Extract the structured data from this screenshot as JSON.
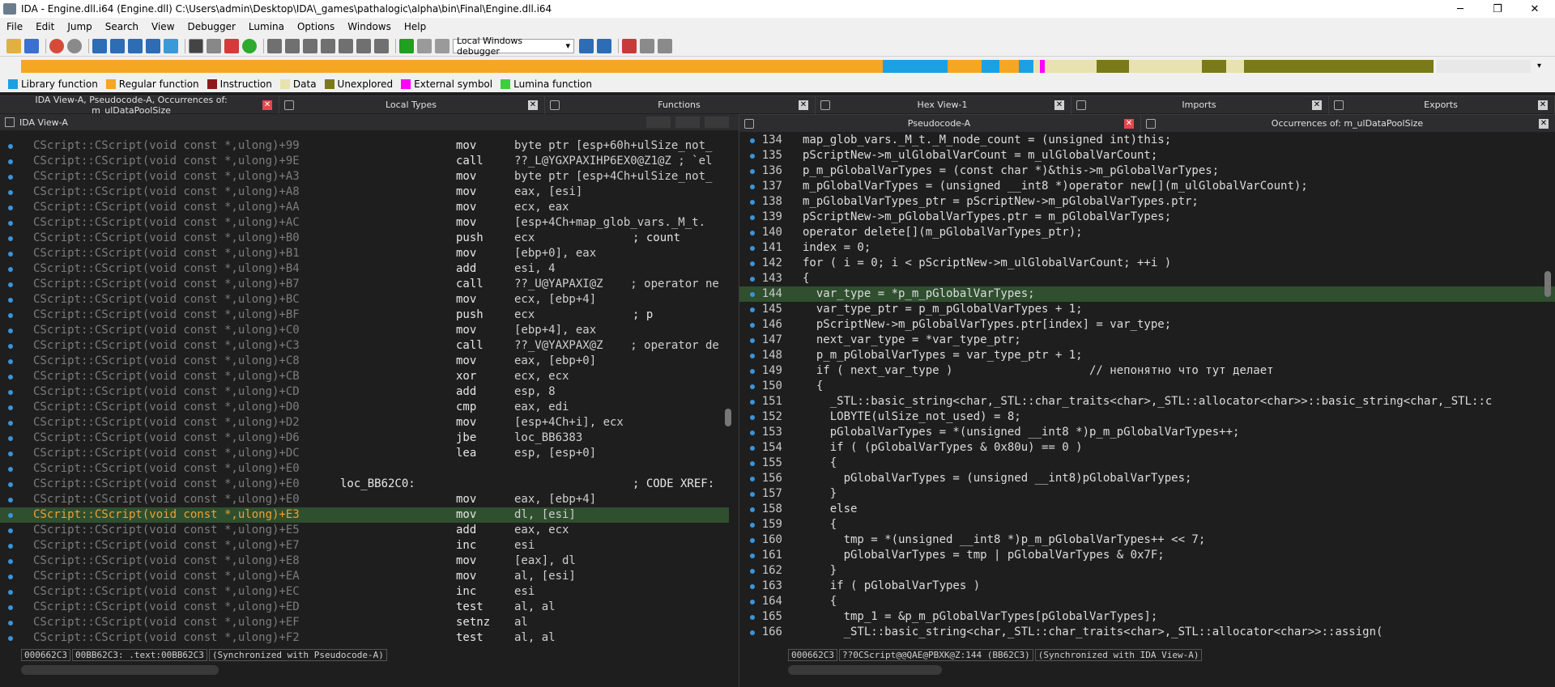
{
  "title": "IDA - Engine.dll.i64 (Engine.dll) C:\\Users\\admin\\Desktop\\IDA\\_games\\pathalogic\\alpha\\bin\\Final\\Engine.dll.i64",
  "window_controls": {
    "minimize": "─",
    "restore": "❐",
    "close": "✕"
  },
  "menu": [
    "File",
    "Edit",
    "Jump",
    "Search",
    "View",
    "Debugger",
    "Lumina",
    "Options",
    "Windows",
    "Help"
  ],
  "toolbar": {
    "debugger": "Local Windows debugger",
    "dropdown": "▾"
  },
  "legend": [
    {
      "label": "Library function",
      "color": "#1ba1e2"
    },
    {
      "label": "Regular function",
      "color": "#f5a623"
    },
    {
      "label": "Instruction",
      "color": "#8b1a1a"
    },
    {
      "label": "Data",
      "color": "#e8e2b0"
    },
    {
      "label": "Unexplored",
      "color": "#7a7a1a"
    },
    {
      "label": "External symbol",
      "color": "#ff00ff"
    },
    {
      "label": "Lumina function",
      "color": "#3ad13a"
    }
  ],
  "tabs_top": [
    {
      "label": "IDA View-A, Pseudocode-A, Occurrences of: m_ulDataPoolSize",
      "close": "✕"
    },
    {
      "label": "Local Types",
      "close": "✕"
    },
    {
      "label": "Functions",
      "close": "✕"
    },
    {
      "label": "Hex View-1",
      "close": "✕"
    },
    {
      "label": "Imports",
      "close": "✕"
    },
    {
      "label": "Exports",
      "close": "✕"
    }
  ],
  "ida_view": {
    "title": "IDA View-A"
  },
  "pseudo_tabs": [
    {
      "label": "Pseudocode-A",
      "close": "✕"
    },
    {
      "label": "Occurrences of: m_ulDataPoolSize",
      "close": "✕"
    }
  ],
  "disasm": [
    {
      "addr": "CScript::CScript(void const *,ulong)+99",
      "mn": "mov",
      "op": "byte ptr [esp+60h+ulSize_not_",
      "cm": ""
    },
    {
      "addr": "CScript::CScript(void const *,ulong)+9E",
      "mn": "call",
      "op": "??_L@YGXPAXIHP6EX0@Z1@Z ; `el",
      "cm": ""
    },
    {
      "addr": "CScript::CScript(void const *,ulong)+A3",
      "mn": "mov",
      "op": "byte ptr [esp+4Ch+ulSize_not_",
      "cm": ""
    },
    {
      "addr": "CScript::CScript(void const *,ulong)+A8",
      "mn": "mov",
      "op": "eax, [esi]",
      "cm": ""
    },
    {
      "addr": "CScript::CScript(void const *,ulong)+AA",
      "mn": "mov",
      "op": "ecx, eax",
      "cm": ""
    },
    {
      "addr": "CScript::CScript(void const *,ulong)+AC",
      "mn": "mov",
      "op": "[esp+4Ch+map_glob_vars._M_t.",
      "cm": ""
    },
    {
      "addr": "CScript::CScript(void const *,ulong)+B0",
      "mn": "push",
      "op": "ecx",
      "cm": "; count"
    },
    {
      "addr": "CScript::CScript(void const *,ulong)+B1",
      "mn": "mov",
      "op": "[ebp+0], eax",
      "cm": ""
    },
    {
      "addr": "CScript::CScript(void const *,ulong)+B4",
      "mn": "add",
      "op": "esi, 4",
      "cm": ""
    },
    {
      "addr": "CScript::CScript(void const *,ulong)+B7",
      "mn": "call",
      "op": "??_U@YAPAXI@Z    ; operator ne",
      "cm": ""
    },
    {
      "addr": "CScript::CScript(void const *,ulong)+BC",
      "mn": "mov",
      "op": "ecx, [ebp+4]",
      "cm": ""
    },
    {
      "addr": "CScript::CScript(void const *,ulong)+BF",
      "mn": "push",
      "op": "ecx",
      "cm": "; p"
    },
    {
      "addr": "CScript::CScript(void const *,ulong)+C0",
      "mn": "mov",
      "op": "[ebp+4], eax",
      "cm": ""
    },
    {
      "addr": "CScript::CScript(void const *,ulong)+C3",
      "mn": "call",
      "op": "??_V@YAXPAX@Z    ; operator de",
      "cm": ""
    },
    {
      "addr": "CScript::CScript(void const *,ulong)+C8",
      "mn": "mov",
      "op": "eax, [ebp+0]",
      "cm": ""
    },
    {
      "addr": "CScript::CScript(void const *,ulong)+CB",
      "mn": "xor",
      "op": "ecx, ecx",
      "cm": ""
    },
    {
      "addr": "CScript::CScript(void const *,ulong)+CD",
      "mn": "add",
      "op": "esp, 8",
      "cm": ""
    },
    {
      "addr": "CScript::CScript(void const *,ulong)+D0",
      "mn": "cmp",
      "op": "eax, edi",
      "cm": ""
    },
    {
      "addr": "CScript::CScript(void const *,ulong)+D2",
      "mn": "mov",
      "op": "[esp+4Ch+i], ecx",
      "cm": ""
    },
    {
      "addr": "CScript::CScript(void const *,ulong)+D6",
      "mn": "jbe",
      "op": "loc_BB6383",
      "cm": ""
    },
    {
      "addr": "CScript::CScript(void const *,ulong)+DC",
      "mn": "lea",
      "op": "esp, [esp+0]",
      "cm": ""
    },
    {
      "addr": "CScript::CScript(void const *,ulong)+E0",
      "mn": "",
      "op": "",
      "cm": ""
    },
    {
      "addr": "CScript::CScript(void const *,ulong)+E0",
      "lbl": "loc_BB62C0:",
      "mn": "",
      "op": "",
      "cm": "; CODE XREF:"
    },
    {
      "addr": "CScript::CScript(void const *,ulong)+E0",
      "mn": "mov",
      "op": "eax, [ebp+4]",
      "cm": ""
    },
    {
      "addr": "CScript::CScript(void const *,ulong)+E3",
      "mn": "mov",
      "op": "dl, [esi]",
      "cm": "",
      "hl": true
    },
    {
      "addr": "CScript::CScript(void const *,ulong)+E5",
      "mn": "add",
      "op": "eax, ecx",
      "cm": ""
    },
    {
      "addr": "CScript::CScript(void const *,ulong)+E7",
      "mn": "inc",
      "op": "esi",
      "cm": ""
    },
    {
      "addr": "CScript::CScript(void const *,ulong)+E8",
      "mn": "mov",
      "op": "[eax], dl",
      "cm": ""
    },
    {
      "addr": "CScript::CScript(void const *,ulong)+EA",
      "mn": "mov",
      "op": "al, [esi]",
      "cm": ""
    },
    {
      "addr": "CScript::CScript(void const *,ulong)+EC",
      "mn": "inc",
      "op": "esi",
      "cm": ""
    },
    {
      "addr": "CScript::CScript(void const *,ulong)+ED",
      "mn": "test",
      "op": "al, al",
      "cm": ""
    },
    {
      "addr": "CScript::CScript(void const *,ulong)+EF",
      "mn": "setnz",
      "op": "al",
      "cm": ""
    },
    {
      "addr": "CScript::CScript(void const *,ulong)+F2",
      "mn": "test",
      "op": "al, al",
      "cm": ""
    }
  ],
  "pseudo": [
    {
      "n": "134",
      "t": "map_glob_vars._M_t._M_node_count = (unsigned int)this;"
    },
    {
      "n": "135",
      "t": "pScriptNew->m_ulGlobalVarCount = m_ulGlobalVarCount;"
    },
    {
      "n": "136",
      "t": "p_m_pGlobalVarTypes = (const char *)&this->m_pGlobalVarTypes;"
    },
    {
      "n": "137",
      "t": "m_pGlobalVarTypes = (unsigned __int8 *)operator new[](m_ulGlobalVarCount);"
    },
    {
      "n": "138",
      "t": "m_pGlobalVarTypes_ptr = pScriptNew->m_pGlobalVarTypes.ptr;"
    },
    {
      "n": "139",
      "t": "pScriptNew->m_pGlobalVarTypes.ptr = m_pGlobalVarTypes;"
    },
    {
      "n": "140",
      "t": "operator delete[](m_pGlobalVarTypes_ptr);"
    },
    {
      "n": "141",
      "t": "index = 0;"
    },
    {
      "n": "142",
      "t": "for ( i = 0; i < pScriptNew->m_ulGlobalVarCount; ++i )"
    },
    {
      "n": "143",
      "t": "{"
    },
    {
      "n": "144",
      "t": "  var_type = *p_m_pGlobalVarTypes;",
      "hl": true
    },
    {
      "n": "145",
      "t": "  var_type_ptr = p_m_pGlobalVarTypes + 1;"
    },
    {
      "n": "146",
      "t": "  pScriptNew->m_pGlobalVarTypes.ptr[index] = var_type;"
    },
    {
      "n": "147",
      "t": "  next_var_type = *var_type_ptr;"
    },
    {
      "n": "148",
      "t": "  p_m_pGlobalVarTypes = var_type_ptr + 1;"
    },
    {
      "n": "149",
      "t": "  if ( next_var_type )                    // непонятно что тут делает"
    },
    {
      "n": "150",
      "t": "  {"
    },
    {
      "n": "151",
      "t": "    _STL::basic_string<char,_STL::char_traits<char>,_STL::allocator<char>>::basic_string<char,_STL::c"
    },
    {
      "n": "152",
      "t": "    LOBYTE(ulSize_not_used) = 8;"
    },
    {
      "n": "153",
      "t": "    pGlobalVarTypes = *(unsigned __int8 *)p_m_pGlobalVarTypes++;"
    },
    {
      "n": "154",
      "t": "    if ( (pGlobalVarTypes & 0x80u) == 0 )"
    },
    {
      "n": "155",
      "t": "    {"
    },
    {
      "n": "156",
      "t": "      pGlobalVarTypes = (unsigned __int8)pGlobalVarTypes;"
    },
    {
      "n": "157",
      "t": "    }"
    },
    {
      "n": "158",
      "t": "    else"
    },
    {
      "n": "159",
      "t": "    {"
    },
    {
      "n": "160",
      "t": "      tmp = *(unsigned __int8 *)p_m_pGlobalVarTypes++ << 7;"
    },
    {
      "n": "161",
      "t": "      pGlobalVarTypes = tmp | pGlobalVarTypes & 0x7F;"
    },
    {
      "n": "162",
      "t": "    }"
    },
    {
      "n": "163",
      "t": "    if ( pGlobalVarTypes )"
    },
    {
      "n": "164",
      "t": "    {"
    },
    {
      "n": "165",
      "t": "      tmp_1 = &p_m_pGlobalVarTypes[pGlobalVarTypes];"
    },
    {
      "n": "166",
      "t": "      _STL::basic_string<char,_STL::char_traits<char>,_STL::allocator<char>>::assign("
    }
  ],
  "status_left": [
    "000662C3",
    "00BB62C3: .text:00BB62C3",
    "(Synchronized with Pseudocode-A)"
  ],
  "status_right": [
    "000662C3",
    "??0CScript@@QAE@PBXK@Z:144 (BB62C3)",
    "(Synchronized with IDA View-A)"
  ]
}
